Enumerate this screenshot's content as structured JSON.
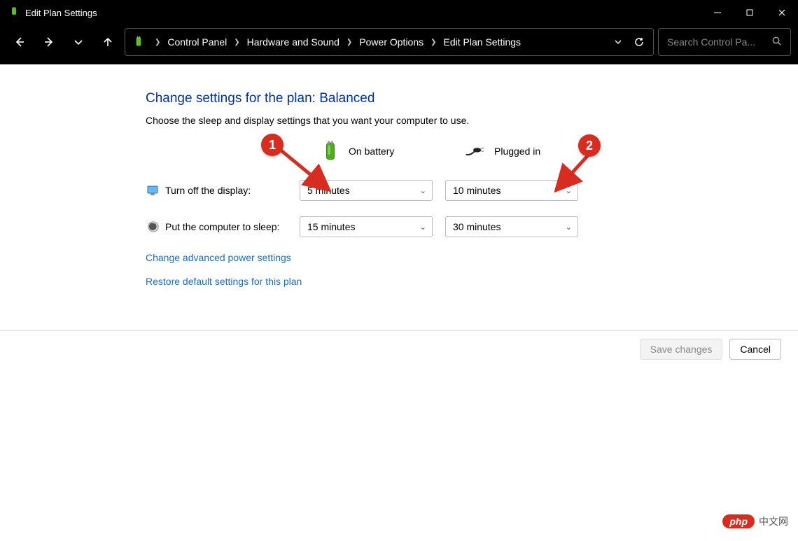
{
  "window": {
    "title": "Edit Plan Settings"
  },
  "breadcrumb": {
    "items": [
      "Control Panel",
      "Hardware and Sound",
      "Power Options",
      "Edit Plan Settings"
    ]
  },
  "search": {
    "placeholder": "Search Control Pa..."
  },
  "page": {
    "heading": "Change settings for the plan: Balanced",
    "subtext": "Choose the sleep and display settings that you want your computer to use.",
    "column_headers": {
      "battery": "On battery",
      "plugged": "Plugged in"
    },
    "rows": {
      "display": {
        "label": "Turn off the display:",
        "battery_value": "5 minutes",
        "plugged_value": "10 minutes"
      },
      "sleep": {
        "label": "Put the computer to sleep:",
        "battery_value": "15 minutes",
        "plugged_value": "30 minutes"
      }
    },
    "links": {
      "advanced": "Change advanced power settings",
      "restore": "Restore default settings for this plan"
    }
  },
  "footer": {
    "save": "Save changes",
    "cancel": "Cancel"
  },
  "annotations": {
    "badge1": "1",
    "badge2": "2"
  },
  "watermark": {
    "pill": "php",
    "text": "中文网"
  }
}
